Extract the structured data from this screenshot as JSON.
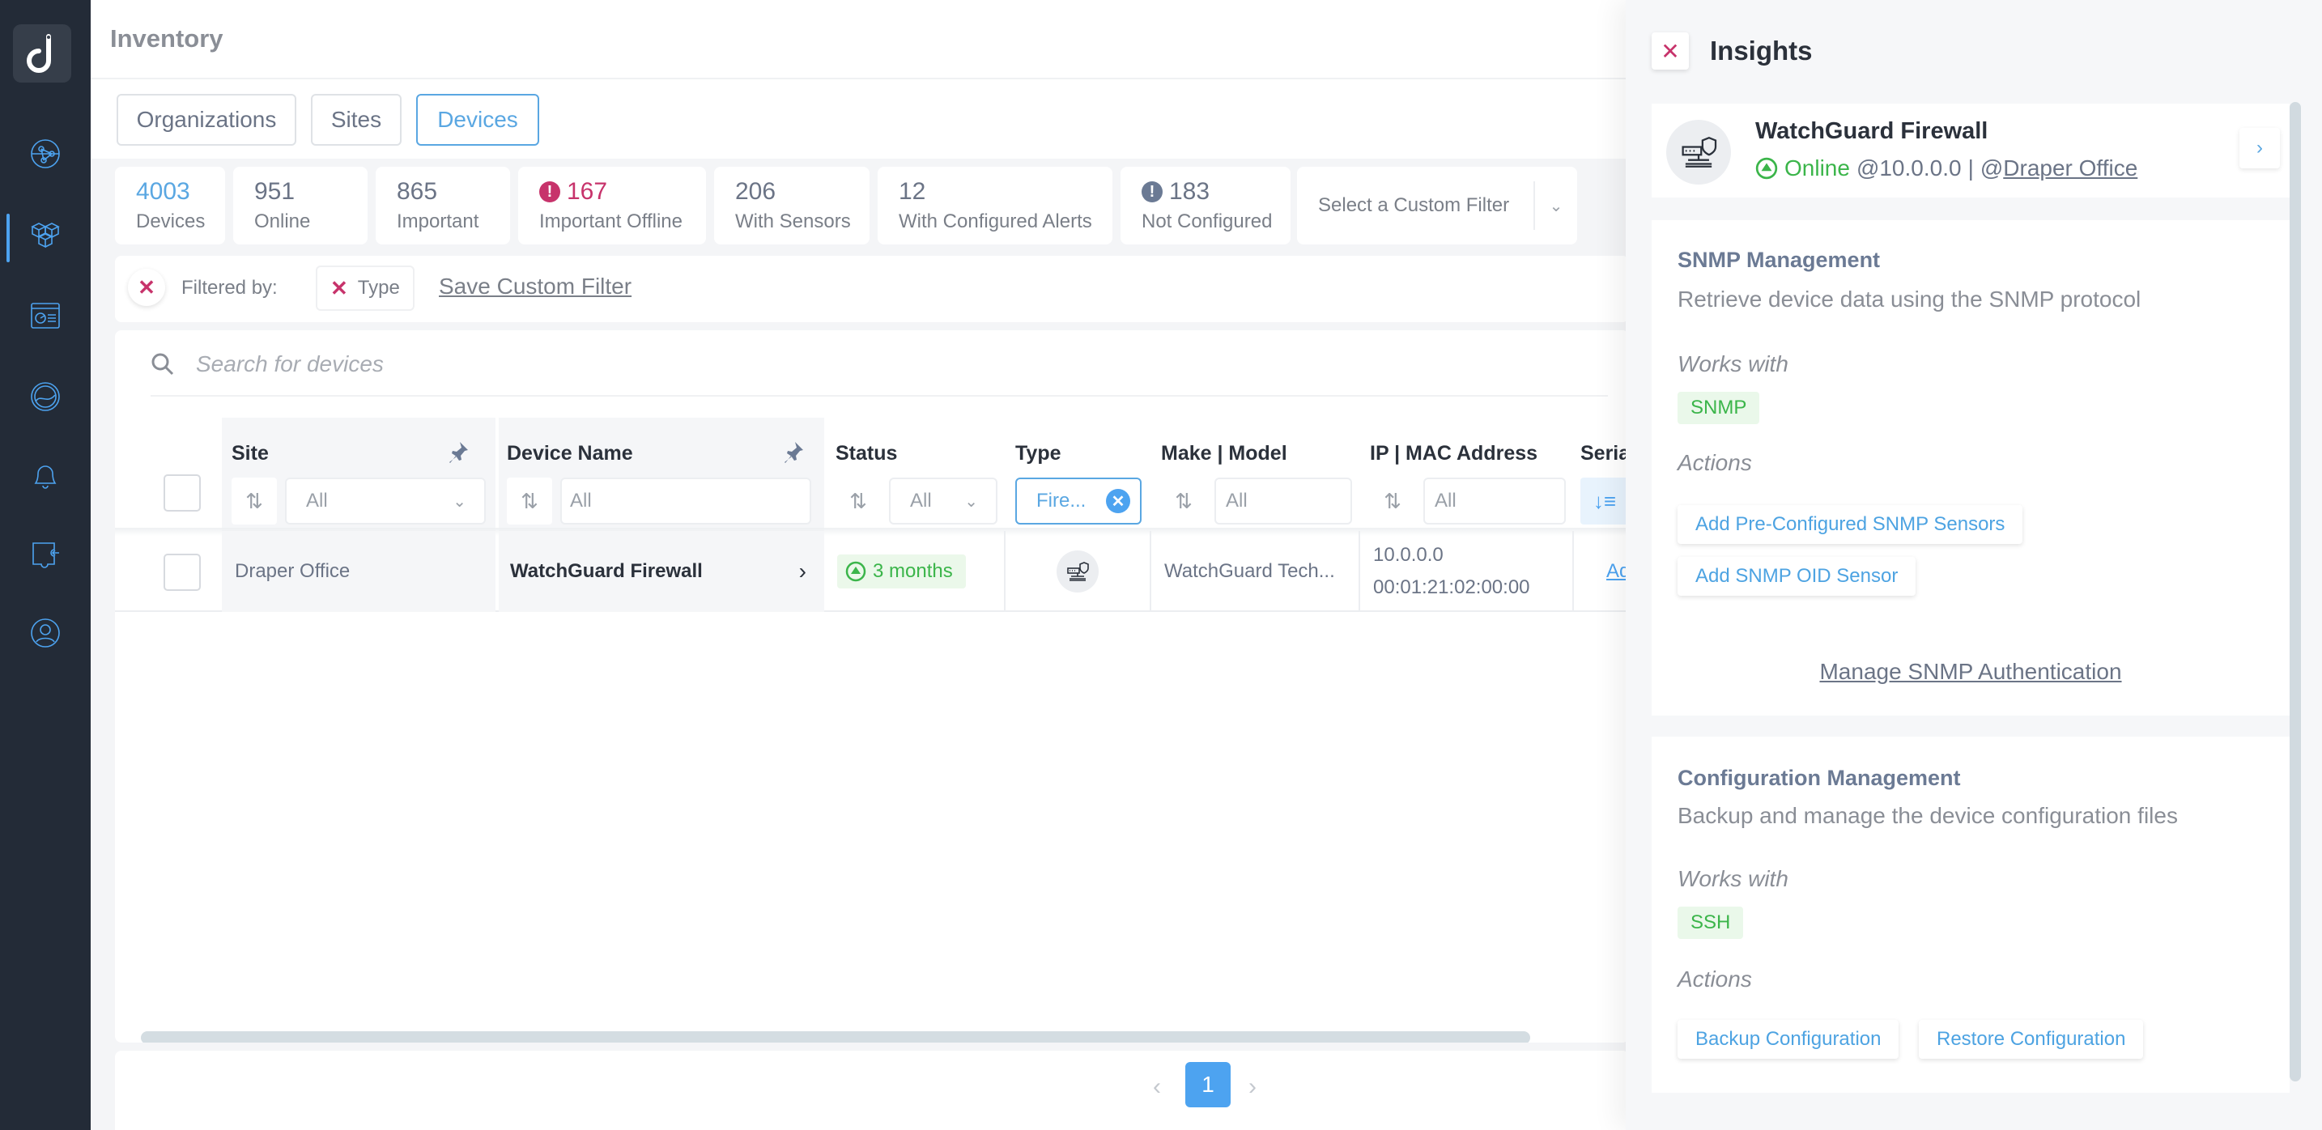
{
  "sidebar": {
    "items": [
      {
        "name": "network-globe",
        "active": false
      },
      {
        "name": "inventory-cubes",
        "active": true
      },
      {
        "name": "dashboard-report",
        "active": false
      },
      {
        "name": "monitoring-gauge",
        "active": false
      },
      {
        "name": "alerts-bell",
        "active": false
      },
      {
        "name": "integrations-puzzle",
        "active": false
      },
      {
        "name": "account-user",
        "active": false
      }
    ]
  },
  "header": {
    "title": "Inventory"
  },
  "tabs": [
    {
      "label": "Organizations",
      "active": false
    },
    {
      "label": "Sites",
      "active": false
    },
    {
      "label": "Devices",
      "active": true
    }
  ],
  "stats": [
    {
      "value": "4003",
      "label": "Devices",
      "color": "#5aa7e2"
    },
    {
      "value": "951",
      "label": "Online"
    },
    {
      "value": "865",
      "label": "Important"
    },
    {
      "value": "167",
      "label": "Important Offline",
      "alert": true,
      "color": "#c7336b"
    },
    {
      "value": "206",
      "label": "With Sensors"
    },
    {
      "value": "12",
      "label": "With Configured Alerts"
    },
    {
      "value": "183",
      "label": "Not Configured",
      "alert": true,
      "color": "#6b7a94"
    }
  ],
  "custom_filter": {
    "placeholder": "Select a Custom Filter"
  },
  "filters": {
    "filtered_by_label": "Filtered by:",
    "chips": [
      {
        "label": "Type"
      }
    ],
    "save_label": "Save Custom Filter"
  },
  "search": {
    "placeholder": "Search for devices"
  },
  "table": {
    "columns": [
      {
        "label": "Site",
        "filter": "All",
        "filter_type": "select",
        "pinned": true
      },
      {
        "label": "Device Name",
        "filter": "All",
        "filter_type": "text",
        "pinned": true
      },
      {
        "label": "Status",
        "filter": "All",
        "filter_type": "select"
      },
      {
        "label": "Type",
        "filter": "Fire...",
        "filter_type": "active"
      },
      {
        "label": "Make | Model",
        "filter": "All",
        "filter_type": "text"
      },
      {
        "label": "IP | MAC Address",
        "filter": "All",
        "filter_type": "text"
      },
      {
        "label": "Seria",
        "filter": "",
        "filter_type": "sort"
      }
    ],
    "rows": [
      {
        "site": "Draper Office",
        "device_name": "WatchGuard Firewall",
        "status": "3 months",
        "type_icon": "firewall-icon",
        "make_model": "WatchGuard Tech...",
        "ip": "10.0.0.0",
        "mac": "00:01:21:02:00:00",
        "serial": "Ad"
      }
    ]
  },
  "pagination": {
    "current": "1",
    "prev": "‹",
    "next": "›"
  },
  "insights": {
    "title": "Insights",
    "device": {
      "name": "WatchGuard Firewall",
      "status": "Online",
      "ip": "@10.0.0.0",
      "separator": "|",
      "site_prefix": "@",
      "site": "Draper Office"
    },
    "sections": [
      {
        "title": "SNMP Management",
        "description": "Retrieve device data using the SNMP protocol",
        "works_with_label": "Works with",
        "protocols": [
          "SNMP"
        ],
        "actions_label": "Actions",
        "actions": [
          "Add Pre-Configured SNMP Sensors",
          "Add SNMP OID Sensor"
        ],
        "link": "Manage SNMP Authentication"
      },
      {
        "title": "Configuration Management",
        "description": "Backup and manage the device configuration files",
        "works_with_label": "Works with",
        "protocols": [
          "SSH"
        ],
        "actions_label": "Actions",
        "actions": [
          "Backup Configuration",
          "Restore Configuration"
        ]
      }
    ]
  },
  "colors": {
    "accent": "#4da3f0",
    "alert": "#c7336b",
    "online": "#3bb54a",
    "sidebar_bg": "#232b37"
  }
}
